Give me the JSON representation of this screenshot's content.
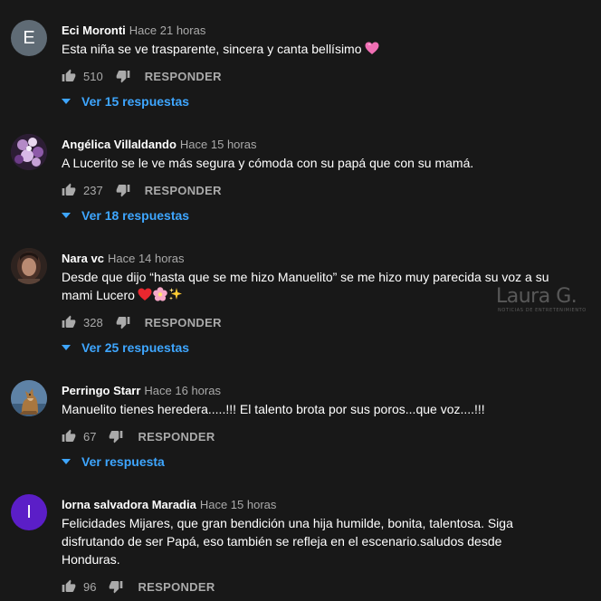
{
  "colors": {
    "background": "#181818",
    "text_primary": "#ffffff",
    "text_secondary": "#aaaaaa",
    "link_blue": "#3ea6ff",
    "avatar_e": "#5f6b75",
    "avatar_i": "#5b1ec7"
  },
  "watermark": {
    "main": "Laura G.",
    "sub": "NOTICIAS DE ENTRETENIMIENTO"
  },
  "comments": [
    {
      "author": "Eci Moronti",
      "time": "Hace 21 horas",
      "avatar_letter": "E",
      "text": "Esta niña se ve trasparente, sincera y canta bellísimo",
      "likes": "510",
      "reply_label": "RESPONDER",
      "replies_label": "Ver 15 respuestas",
      "emoji_icons": [
        "heart-icon"
      ]
    },
    {
      "author": "Angélica Villaldando",
      "time": "Hace 15 horas",
      "text": "A Lucerito se le ve más segura y cómoda con su papá que con su mamá.",
      "likes": "237",
      "reply_label": "RESPONDER",
      "replies_label": "Ver 18 respuestas"
    },
    {
      "author": "Nara vc",
      "time": "Hace 14 horas",
      "text_line1": "Desde que dijo “hasta que se me hizo Manuelito” se me hizo muy parecida su voz a su",
      "text_line2": "mami Lucero",
      "likes": "328",
      "reply_label": "RESPONDER",
      "replies_label": "Ver 25 respuestas",
      "emoji_icons": [
        "red-heart-icon",
        "blossom-icon",
        "sparkles-icon"
      ]
    },
    {
      "author": "Perringo Starr",
      "time": "Hace 16 horas",
      "text": "Manuelito tienes heredera.....!!! El talento brota por sus poros...que voz....!!!",
      "likes": "67",
      "reply_label": "RESPONDER",
      "replies_label": "Ver respuesta"
    },
    {
      "author": "lorna salvadora Maradia",
      "time": "Hace 15 horas",
      "avatar_letter": "I",
      "text_line1": "Felicidades Mijares, que gran bendición una hija humilde, bonita, talentosa. Siga",
      "text_line2": "disfrutando de ser Papá, eso también se refleja en el escenario.saludos desde",
      "text_line3": "Honduras.",
      "likes": "96",
      "reply_label": "RESPONDER"
    }
  ]
}
